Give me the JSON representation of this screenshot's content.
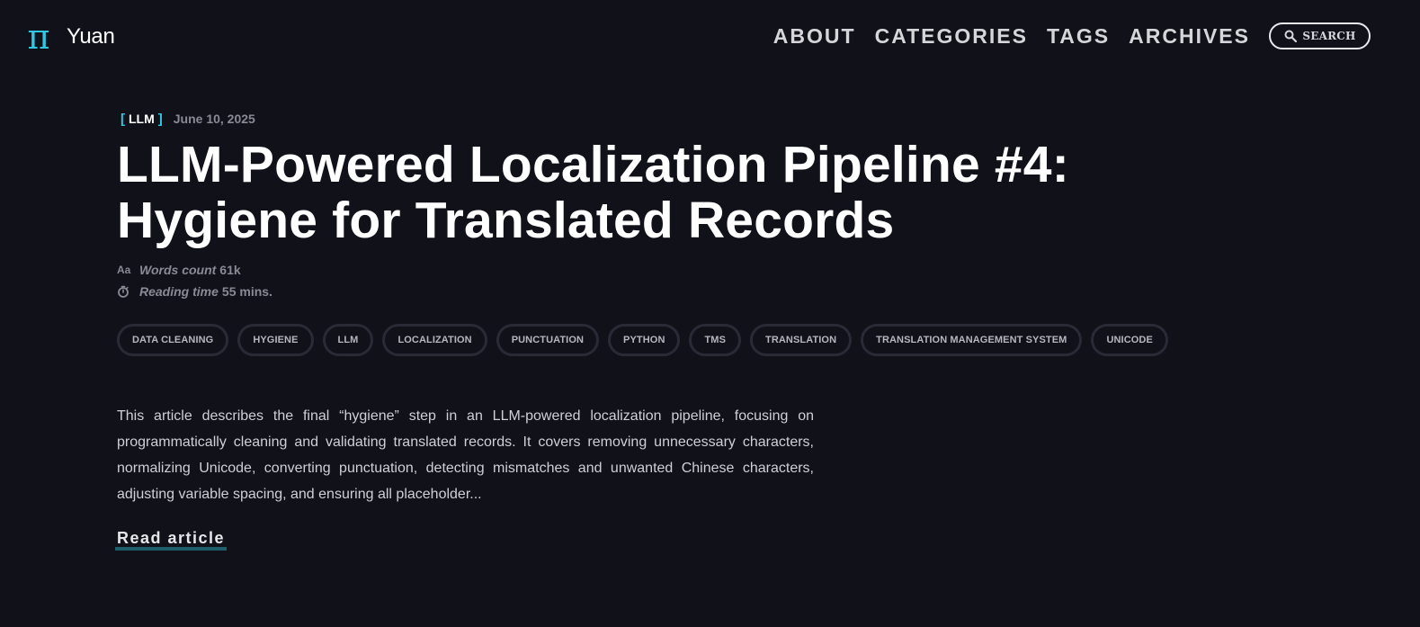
{
  "header": {
    "logo_mark": "π",
    "site_name": "Yuan",
    "nav": [
      {
        "label": "ABOUT"
      },
      {
        "label": "CATEGORIES"
      },
      {
        "label": "TAGS"
      },
      {
        "label": "ARCHIVES"
      }
    ],
    "search_label": "SEARCH",
    "accent_color": "#2ec8e3"
  },
  "post": {
    "category": "LLM",
    "date": "June 10, 2025",
    "title": "LLM-Powered Localization Pipeline #4: Hygiene for Translated Records",
    "words_icon_text": "Aa",
    "words_label": "Words count",
    "words_value": "61k",
    "reading_label": "Reading time",
    "reading_value": "55 mins.",
    "tags": [
      "DATA CLEANING",
      "HYGIENE",
      "LLM",
      "LOCALIZATION",
      "PUNCTUATION",
      "PYTHON",
      "TMS",
      "TRANSLATION",
      "TRANSLATION MANAGEMENT SYSTEM",
      "UNICODE"
    ],
    "excerpt": "This article describes the final “hygiene” step in an LLM-powered localization pipeline, focusing on programmatically cleaning and validating translated records. It covers removing unnecessary characters, normalizing Unicode, converting punctuation, detecting mismatches and unwanted Chinese characters, adjusting variable spacing, and ensuring all placeholder...",
    "read_more": "Read article"
  }
}
